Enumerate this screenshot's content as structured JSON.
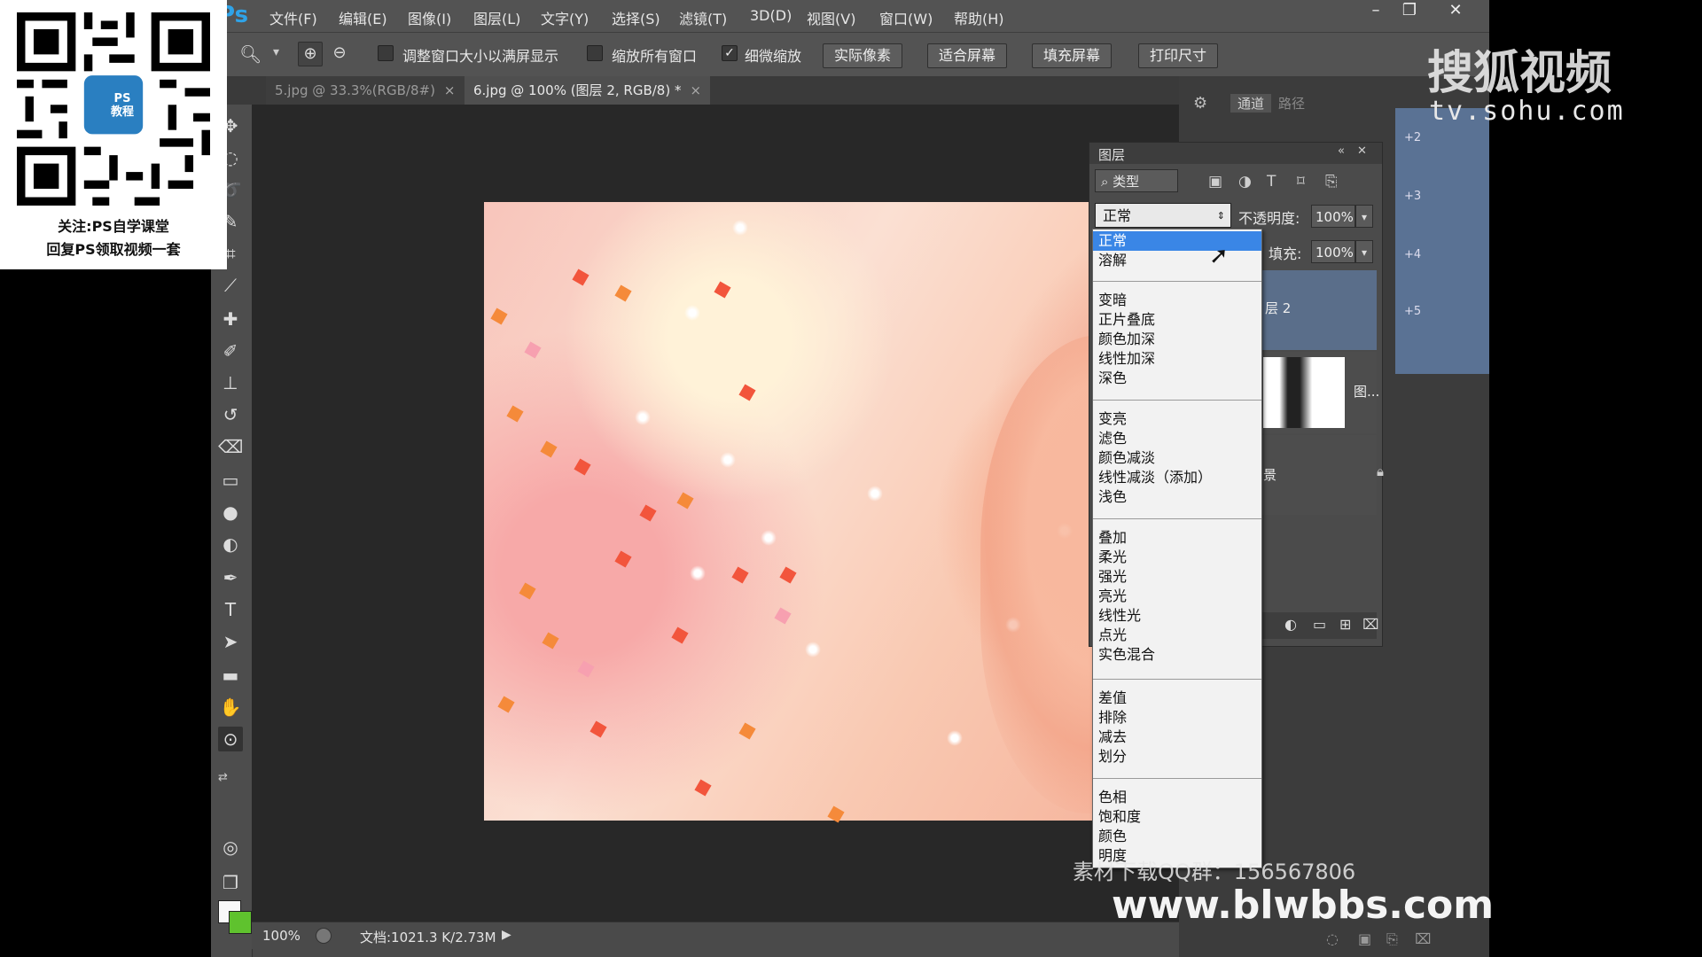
{
  "app": {
    "logo": "Ps",
    "menu": [
      "文件(F)",
      "编辑(E)",
      "图像(I)",
      "图层(L)",
      "文字(Y)",
      "选择(S)",
      "滤镜(T)",
      "3D(D)",
      "视图(V)",
      "窗口(W)",
      "帮助(H)"
    ],
    "window_buttons": [
      "–",
      "❐",
      "✕"
    ]
  },
  "options_bar": {
    "zoom_icon": "zoom-icon",
    "checkbox_resize": {
      "label": "调整窗口大小以满屏显示",
      "checked": false
    },
    "checkbox_zoom_all": {
      "label": "缩放所有窗口",
      "checked": false
    },
    "checkbox_scrubby": {
      "label": "细微缩放",
      "checked": true
    },
    "buttons": [
      "实际像素",
      "适合屏幕",
      "填充屏幕",
      "打印尺寸"
    ]
  },
  "tabs": [
    {
      "label": "5.jpg @ 33.3%(RGB/8#)",
      "active": false
    },
    {
      "label": "6.jpg @ 100% (图层 2, RGB/8) *",
      "active": true
    }
  ],
  "status_bar": {
    "zoom": "100%",
    "doc_info": "文档:1021.3 K/2.73M"
  },
  "panels": {
    "tabs": [
      "通道",
      "路径"
    ],
    "layers_title": "图层",
    "filter_kind": "类型",
    "blend_mode": "正常",
    "opacity_label": "不透明度:",
    "opacity_value": "100%",
    "fill_label": "填充:",
    "fill_value": "100%",
    "layer_names": [
      "层 2",
      "图...",
      "景"
    ],
    "side_numbers": [
      "+2",
      "+3",
      "+4",
      "+5"
    ]
  },
  "blend_dropdown": {
    "groups": [
      [
        "正常",
        "溶解"
      ],
      [
        "变暗",
        "正片叠底",
        "颜色加深",
        "线性加深",
        "深色"
      ],
      [
        "变亮",
        "滤色",
        "颜色减淡",
        "线性减淡（添加）",
        "浅色"
      ],
      [
        "叠加",
        "柔光",
        "强光",
        "亮光",
        "线性光",
        "点光",
        "实色混合"
      ],
      [
        "差值",
        "排除",
        "减去",
        "划分"
      ],
      [
        "色相",
        "饱和度",
        "颜色",
        "明度"
      ]
    ],
    "selected": "正常"
  },
  "overlays": {
    "qr_badge": "PS\n教程",
    "qr_caption_1": "关注:PS自学课堂",
    "qr_caption_2": "回复PS领取视频一套",
    "sohu_logo": "搜狐视频",
    "sohu_url": "tv.sohu.com",
    "qq_text": "素材下载QQ群：156567806",
    "site_url": "www.blwbbs.com"
  },
  "colors": {
    "accent": "#3a86e6",
    "foreground": "#f8f8f8",
    "background": "#5fc22e"
  }
}
